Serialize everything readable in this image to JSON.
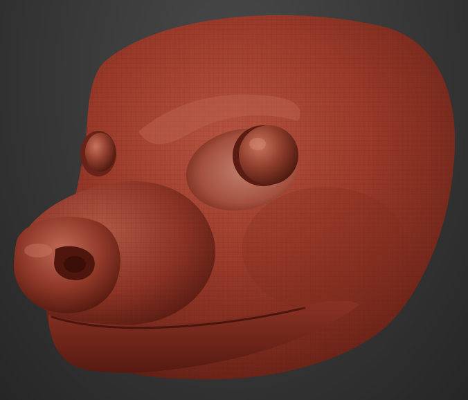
{
  "scene": {
    "background_color": "#333333",
    "model_color": "#9c3d2c",
    "model_highlight": "#c9705c",
    "model_shadow": "#5a1f16",
    "subject": "sculpt-head-model"
  }
}
